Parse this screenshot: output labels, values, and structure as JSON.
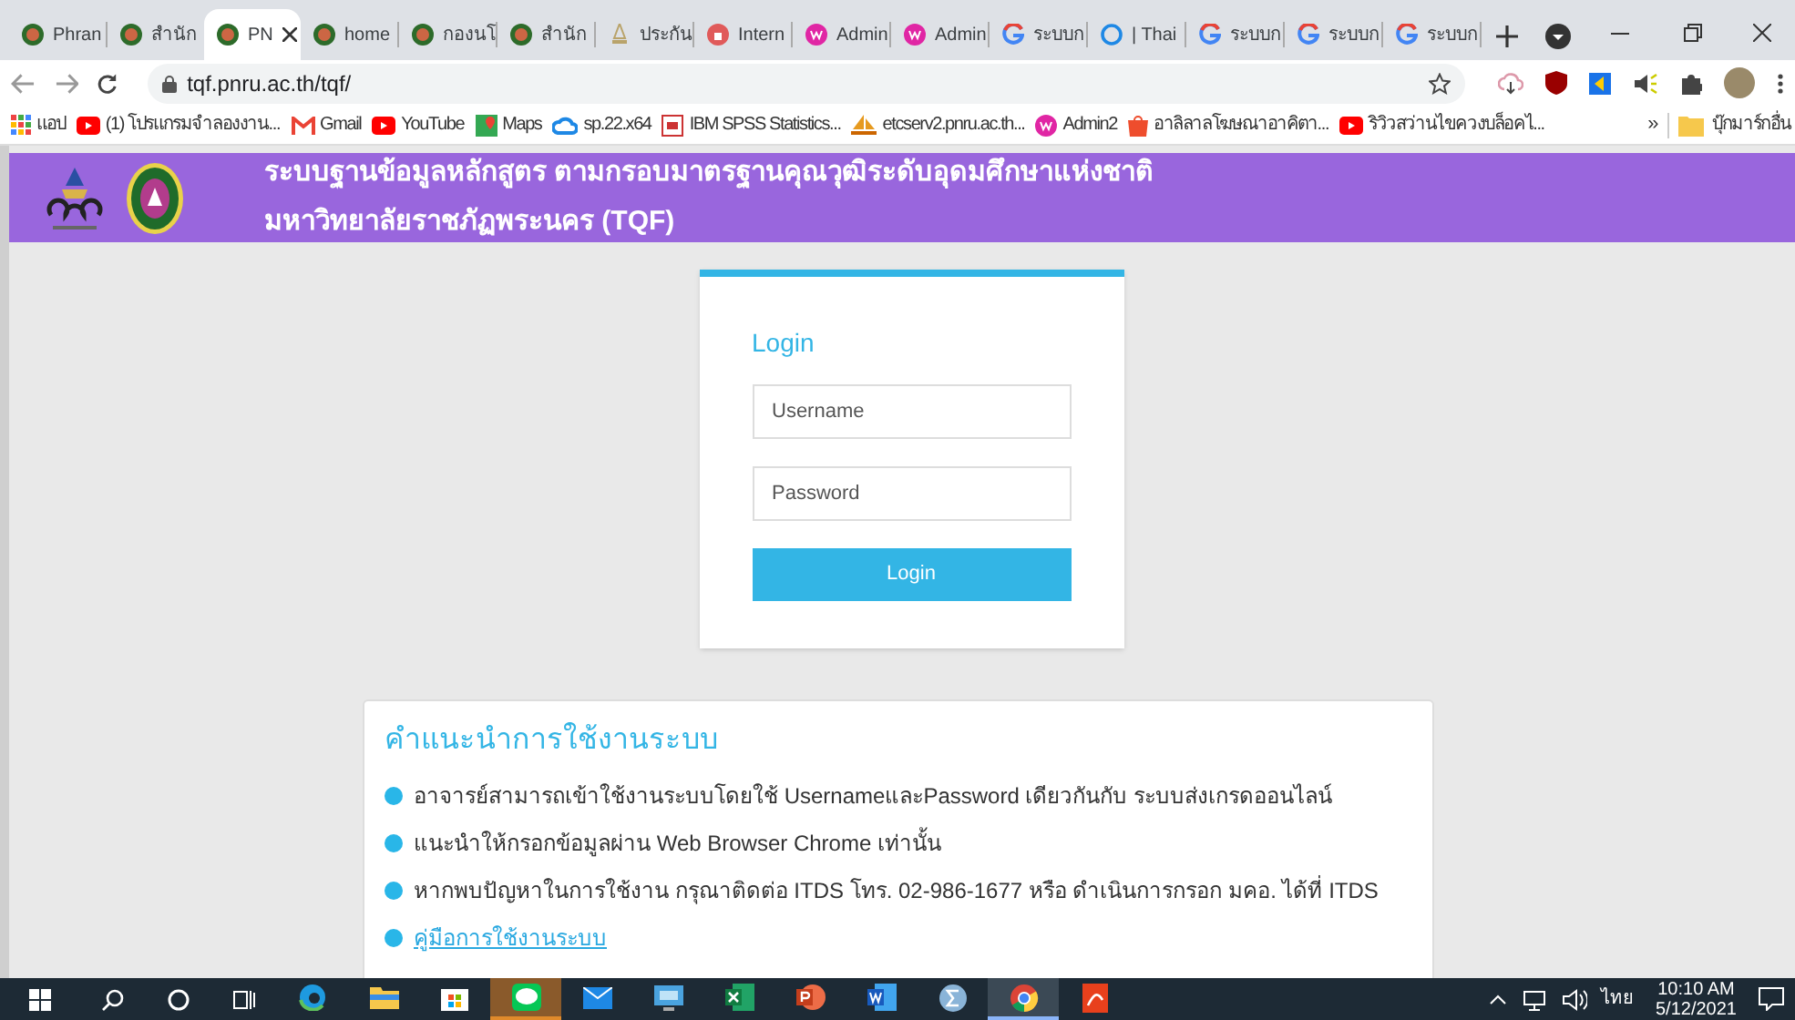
{
  "browser": {
    "tabs": [
      {
        "title": "Phran",
        "kind": "seal",
        "selected": false
      },
      {
        "title": "สำนัก",
        "kind": "seal",
        "selected": false
      },
      {
        "title": "PN",
        "kind": "seal",
        "selected": true
      },
      {
        "title": "home",
        "kind": "seal",
        "selected": false
      },
      {
        "title": "กองนโ",
        "kind": "seal",
        "selected": false
      },
      {
        "title": "สำนัก",
        "kind": "seal",
        "selected": false
      },
      {
        "title": "ประกัน",
        "kind": "temple",
        "selected": false
      },
      {
        "title": "Intern",
        "kind": "lock",
        "selected": false
      },
      {
        "title": "Admin",
        "kind": "admin",
        "selected": false
      },
      {
        "title": "Admin",
        "kind": "admin",
        "selected": false
      },
      {
        "title": "ระบบก",
        "kind": "google",
        "selected": false
      },
      {
        "title": "| Thai",
        "kind": "ring",
        "selected": false
      },
      {
        "title": "ระบบก",
        "kind": "google",
        "selected": false
      },
      {
        "title": "ระบบก",
        "kind": "google",
        "selected": false
      },
      {
        "title": "ระบบก",
        "kind": "google",
        "selected": false
      }
    ],
    "address": "tqf.pnru.ac.th/tqf/",
    "bookmarks": [
      {
        "label": "แอป",
        "kind": "apps"
      },
      {
        "label": "(1) โปรแกรมจำลองงาน...",
        "kind": "youtube"
      },
      {
        "label": "Gmail",
        "kind": "gmail"
      },
      {
        "label": "YouTube",
        "kind": "youtube"
      },
      {
        "label": "Maps",
        "kind": "maps"
      },
      {
        "label": "sp.22.x64",
        "kind": "cloud"
      },
      {
        "label": "IBM SPSS Statistics...",
        "kind": "lz"
      },
      {
        "label": "etcserv2.pnru.ac.th...",
        "kind": "pma"
      },
      {
        "label": "Admin2",
        "kind": "admin"
      },
      {
        "label": "อาลิลาลโฆษณาอาคิตา...",
        "kind": "shopee"
      },
      {
        "label": "ริวิวสว่านไขควงบล็อคไ...",
        "kind": "youtube"
      }
    ],
    "more_bookmarks": "»",
    "other_bookmarks": "บุ๊กมาร์กอื่น"
  },
  "header": {
    "title_line_1": "ระบบฐานข้อมูลหลักสูตร ตามกรอบมาตรฐานคุณวุฒิระดับอุดมศึกษาแห่งชาติ",
    "title_line_2": "มหาวิทยาลัยราชภัฏพระนคร (TQF)"
  },
  "login": {
    "heading": "Login",
    "username": {
      "placeholder": "Username"
    },
    "password": {
      "placeholder": "Password"
    },
    "button": "Login"
  },
  "instructions": {
    "heading": "คำแนะนำการใช้งานระบบ",
    "items": [
      {
        "text": "อาจารย์สามารถเข้าใช้งานระบบโดยใช้ UsernameและPassword เดียวกันกับ ระบบส่งเกรดออนไลน์",
        "kind": "text"
      },
      {
        "text": "แนะนำให้กรอกข้อมูลผ่าน Web Browser Chrome เท่านั้น",
        "kind": "text"
      },
      {
        "text": "หากพบปัญหาในการใช้งาน กรุณาติดต่อ ITDS โทร. 02-986-1677 หรือ ดำเนินการกรอก มคอ. ได้ที่ ITDS",
        "kind": "text"
      },
      {
        "text": "คู่มือการใช้งานระบบ",
        "kind": "link"
      }
    ]
  },
  "taskbar": {
    "apps": [
      {
        "kind": "edge",
        "selected": false,
        "attention": false
      },
      {
        "kind": "folder",
        "selected": false,
        "attention": false
      },
      {
        "kind": "store",
        "selected": false,
        "attention": false
      },
      {
        "kind": "line",
        "selected": false,
        "attention": true
      },
      {
        "kind": "mail",
        "selected": false,
        "attention": false
      },
      {
        "kind": "monitor",
        "selected": false,
        "attention": false
      },
      {
        "kind": "excel",
        "selected": false,
        "attention": false
      },
      {
        "kind": "powerpoint",
        "selected": false,
        "attention": false
      },
      {
        "kind": "word",
        "selected": false,
        "attention": false
      },
      {
        "kind": "calc",
        "selected": false,
        "attention": false
      },
      {
        "kind": "chrome",
        "selected": true,
        "attention": false
      },
      {
        "kind": "pdf",
        "selected": false,
        "attention": false
      }
    ],
    "language": "ไทย",
    "time": "10:10 AM",
    "date": "5/12/2021"
  }
}
